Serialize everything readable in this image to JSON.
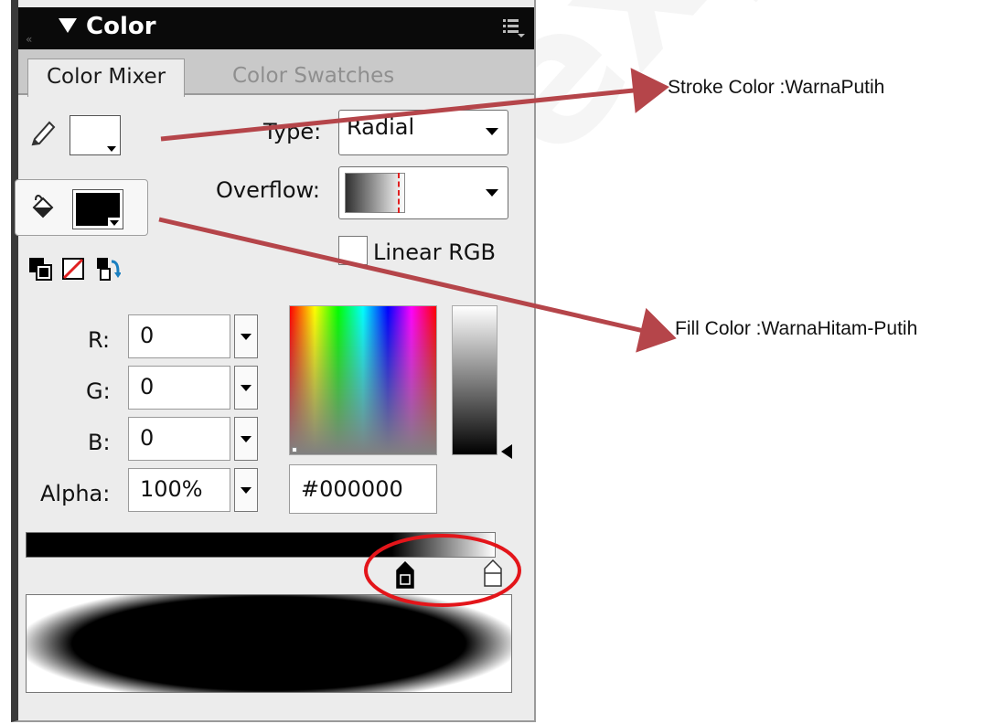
{
  "panel": {
    "title": "Color",
    "tabs": [
      {
        "label": "Color Mixer",
        "active": true
      },
      {
        "label": "Color Swatches",
        "active": false
      }
    ]
  },
  "stroke": {
    "icon": "pencil-icon",
    "color": "#ffffff"
  },
  "fill": {
    "icon": "paint-bucket-icon",
    "color": "#000000"
  },
  "tools": {
    "icons": [
      "black-white-default-icon",
      "no-color-icon",
      "swap-colors-icon"
    ]
  },
  "type": {
    "label": "Type:",
    "value": "Radial"
  },
  "overflow": {
    "label": "Overflow:"
  },
  "linear_rgb": {
    "label": "Linear RGB",
    "checked": false
  },
  "rgb": {
    "r": {
      "label": "R:",
      "value": "0"
    },
    "g": {
      "label": "G:",
      "value": "0"
    },
    "b": {
      "label": "B:",
      "value": "0"
    },
    "alpha": {
      "label": "Alpha:",
      "value": "100%"
    }
  },
  "hex": {
    "value": "#000000"
  },
  "gradient": {
    "stops": [
      {
        "color": "#000000",
        "selected": true
      },
      {
        "color": "#ffffff",
        "selected": false
      }
    ]
  },
  "annotations": {
    "stroke": "Stroke Color :WarnaPutih",
    "fill": "Fill Color :WarnaHitam-Putih"
  },
  "colors": {
    "annotation_arrow": "#b5454a",
    "highlight_circle": "#e3151a",
    "title_bar": "#0a0a0a"
  }
}
